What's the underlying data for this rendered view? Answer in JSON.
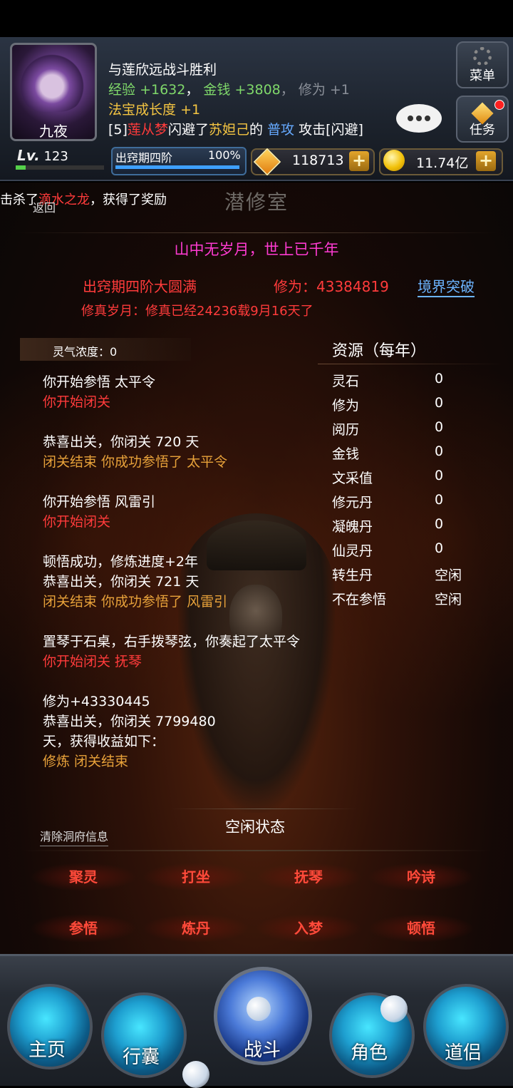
{
  "header": {
    "avatar_name": "九夜",
    "menu_label": "菜单",
    "task_label": "任务",
    "news": {
      "line1": "与莲欣远战斗胜利",
      "exp_label": "经验",
      "exp_value": "+1632",
      "money_label": "金钱",
      "money_value": "+3808",
      "cult_label": "修为",
      "cult_value": "+1",
      "treasure_label": "法宝成长度",
      "treasure_value": "+1",
      "combat_prefix": "[5]",
      "combat_actor": "莲从梦",
      "combat_verb": "闪避了",
      "combat_target": "苏妲己",
      "combat_of": "的",
      "combat_skill": "普攻",
      "combat_result": "攻击[闪避]"
    }
  },
  "stats": {
    "level_label": "Lv.",
    "level": "123",
    "level_progress": 0.11,
    "realm_name": "出窍期四阶",
    "realm_percent": "100%",
    "gems": "118713",
    "gold": "11.74亿",
    "plus": "+"
  },
  "scene": {
    "kill_prefix": "击杀了",
    "kill_target": "滴水之龙",
    "kill_suffix": "，获得了奖励",
    "back_label": "返回",
    "room_title": "潜修室",
    "motto": "山中无岁月，世上已千年",
    "realm_full": "出窍期四阶大圆满",
    "cultivation": "修为：43384819",
    "breakthrough": "境界突破",
    "years": "修真岁月：修真已经24236载9月16天了",
    "spirit": "灵气浓度：0",
    "resource_title": "资源（每年）",
    "idle_status": "空闲状态",
    "clear_label": "清除洞府信息"
  },
  "resources": [
    {
      "k": "灵石",
      "v": "0"
    },
    {
      "k": "修为",
      "v": "0"
    },
    {
      "k": "阅历",
      "v": "0"
    },
    {
      "k": "金钱",
      "v": "0"
    },
    {
      "k": "文采值",
      "v": "0"
    },
    {
      "k": "修元丹",
      "v": "0"
    },
    {
      "k": "凝魄丹",
      "v": "0"
    },
    {
      "k": "仙灵丹",
      "v": "0"
    },
    {
      "k": "转生丹",
      "v": "空闲"
    },
    {
      "k": "不在参悟",
      "v": "空闲"
    }
  ],
  "log": {
    "b1_l1": "你开始参悟 太平令",
    "b1_l2": "你开始闭关",
    "b2_l1": "恭喜出关，你闭关 720 天",
    "b2_l2": "闭关结束 你成功参悟了 太平令",
    "b3_l1": "你开始参悟 风雷引",
    "b3_l2": "你开始闭关",
    "b4_l1": "顿悟成功，修炼进度+2年",
    "b4_l2": "恭喜出关，你闭关 721 天",
    "b4_l3": "闭关结束 你成功参悟了 风雷引",
    "b5_l1": "置琴于石桌，右手拨琴弦，你奏起了太平令",
    "b5_l2": "你开始闭关 抚琴",
    "b6_l1": "修为+43330445",
    "b6_l2": "恭喜出关，你闭关 7799480",
    "b6_l3": "天，获得收益如下：",
    "b6_l4": "修炼 闭关结束"
  },
  "actions": [
    "聚灵",
    "打坐",
    "抚琴",
    "吟诗",
    "参悟",
    "炼丹",
    "入梦",
    "顿悟"
  ],
  "nav": {
    "home": "主页",
    "bag": "行囊",
    "battle": "战斗",
    "role": "角色",
    "partner": "道侣"
  }
}
